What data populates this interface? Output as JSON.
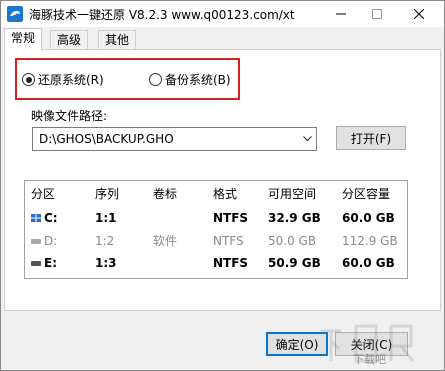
{
  "window": {
    "title": "海豚技术一键还原 V8.2.3 www.q00123.com/xt"
  },
  "tabs": [
    {
      "label": "常规",
      "active": true
    },
    {
      "label": "高级",
      "active": false
    },
    {
      "label": "其他",
      "active": false
    }
  ],
  "mode": {
    "restore_label": "还原系统(R)",
    "backup_label": "备份系统(B)",
    "selected": "restore"
  },
  "image": {
    "path_label": "映像文件路径:",
    "path_value": "D:\\GHOS\\BACKUP.GHO",
    "open_label": "打开(F)"
  },
  "partitions": {
    "headers": [
      "分区",
      "序列",
      "卷标",
      "格式",
      "可用空间",
      "分区容量"
    ],
    "rows": [
      {
        "drive": "C:",
        "seq": "1:1",
        "label": "",
        "format": "NTFS",
        "free": "32.9 GB",
        "size": "60.0 GB",
        "style": "selected"
      },
      {
        "drive": "D:",
        "seq": "1:2",
        "label": "软件",
        "format": "NTFS",
        "free": "50.0 GB",
        "size": "112.9 GB",
        "style": "disabled"
      },
      {
        "drive": "E:",
        "seq": "1:3",
        "label": "",
        "format": "NTFS",
        "free": "50.9 GB",
        "size": "60.0 GB",
        "style": "normal"
      }
    ]
  },
  "footer": {
    "ok_label": "确定(O)",
    "close_label": "关闭(C)"
  },
  "watermark": {
    "text": "下载吧"
  },
  "colors": {
    "highlight_border": "#d42020",
    "accent": "#0078d7",
    "system_drive_icon": "#2a6ebd"
  }
}
